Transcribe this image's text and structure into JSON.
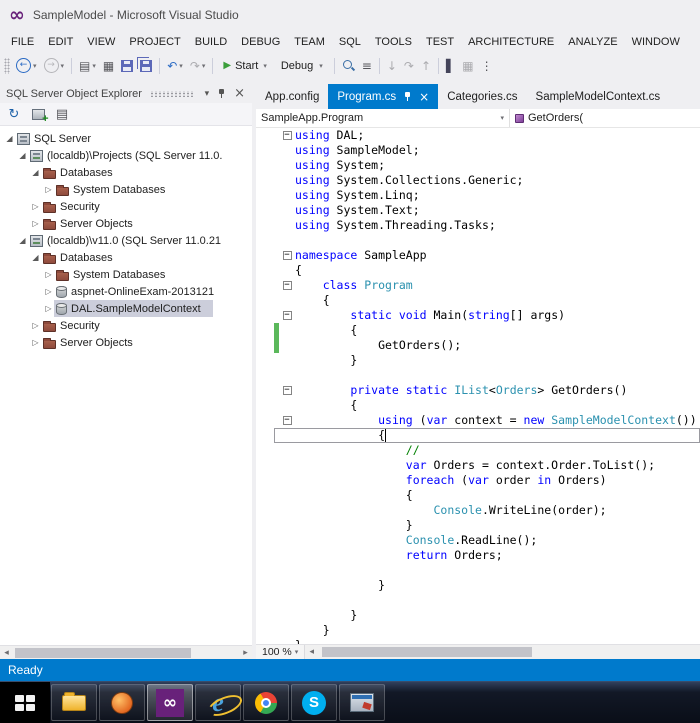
{
  "titlebar": {
    "title": "SampleModel - Microsoft Visual Studio"
  },
  "menu": {
    "items": [
      "FILE",
      "EDIT",
      "VIEW",
      "PROJECT",
      "BUILD",
      "DEBUG",
      "TEAM",
      "SQL",
      "TOOLS",
      "TEST",
      "ARCHITECTURE",
      "ANALYZE",
      "WINDOW"
    ]
  },
  "toolbar": {
    "start_label": "Start",
    "configuration": "Debug",
    "buttons": [
      {
        "type": "icon",
        "name": "navigate-backward",
        "glyph": "←",
        "cls": "circ blue",
        "dd": true
      },
      {
        "type": "icon",
        "name": "navigate-forward",
        "glyph": "→",
        "cls": "circ disabled",
        "dd": true
      },
      {
        "type": "sep"
      },
      {
        "type": "icon",
        "name": "new-project",
        "glyph": "▤",
        "cls": "ink",
        "dd": true
      },
      {
        "type": "icon",
        "name": "add-item",
        "glyph": "▦",
        "cls": "ink"
      },
      {
        "type": "icon",
        "name": "save",
        "cls": "floppy"
      },
      {
        "type": "icon",
        "name": "save-all",
        "cls": "floppy double"
      },
      {
        "type": "sep"
      },
      {
        "type": "icon",
        "name": "undo",
        "glyph": "↶",
        "cls": "blue",
        "dd": true
      },
      {
        "type": "icon",
        "name": "redo",
        "glyph": "↷",
        "cls": "disabled",
        "dd": true
      },
      {
        "type": "sep"
      },
      {
        "type": "start"
      },
      {
        "type": "combo",
        "name": "solution-configurations"
      },
      {
        "type": "sep"
      },
      {
        "type": "icon",
        "name": "find-in-files",
        "cls": "magnifier"
      },
      {
        "type": "icon",
        "name": "solution-platforms",
        "glyph": "≡",
        "cls": "ink"
      },
      {
        "type": "sep"
      },
      {
        "type": "icon",
        "name": "step-into",
        "glyph": "↓",
        "cls": "disabled"
      },
      {
        "type": "icon",
        "name": "step-over",
        "glyph": "↷",
        "cls": "disabled"
      },
      {
        "type": "icon",
        "name": "step-out",
        "glyph": "↑",
        "cls": "disabled"
      },
      {
        "type": "sep"
      },
      {
        "type": "icon",
        "name": "breakpoints",
        "glyph": "▌",
        "cls": "dark"
      },
      {
        "type": "icon",
        "name": "output-window",
        "glyph": "▦",
        "cls": "disabled"
      },
      {
        "type": "icon",
        "name": "toolbar-overflow",
        "glyph": "⋮",
        "cls": "ink"
      }
    ]
  },
  "explorer": {
    "title": "SQL Server Object Explorer",
    "toolbar_icons": [
      {
        "name": "refresh",
        "glyph": "↻",
        "cls": "xblue"
      },
      {
        "name": "add-sql-server",
        "kind": "addsrv"
      },
      {
        "name": "group-by",
        "glyph": "▤",
        "cls": "xink"
      }
    ],
    "tree": [
      {
        "depth": 0,
        "state": "expanded",
        "icon": "server",
        "label": "SQL Server"
      },
      {
        "depth": 1,
        "state": "expanded",
        "icon": "instance",
        "label": "(localdb)\\Projects (SQL Server 11.0."
      },
      {
        "depth": 2,
        "state": "expanded",
        "icon": "folder",
        "label": "Databases"
      },
      {
        "depth": 3,
        "state": "collapsed",
        "icon": "folder",
        "label": "System Databases"
      },
      {
        "depth": 2,
        "state": "collapsed",
        "icon": "folder",
        "label": "Security"
      },
      {
        "depth": 2,
        "state": "collapsed",
        "icon": "folder",
        "label": "Server Objects"
      },
      {
        "depth": 1,
        "state": "expanded",
        "icon": "instance",
        "label": "(localdb)\\v11.0 (SQL Server 11.0.21"
      },
      {
        "depth": 2,
        "state": "expanded",
        "icon": "folder",
        "label": "Databases"
      },
      {
        "depth": 3,
        "state": "collapsed",
        "icon": "folder",
        "label": "System Databases"
      },
      {
        "depth": 3,
        "state": "collapsed",
        "icon": "database",
        "label": "aspnet-OnlineExam-2013121"
      },
      {
        "depth": 3,
        "state": "collapsed",
        "icon": "database",
        "label": "DAL.SampleModelContext",
        "selected": true
      },
      {
        "depth": 2,
        "state": "collapsed",
        "icon": "folder",
        "label": "Security"
      },
      {
        "depth": 2,
        "state": "collapsed",
        "icon": "folder",
        "label": "Server Objects"
      }
    ]
  },
  "editor": {
    "tabs": [
      {
        "label": "App.config",
        "active": false
      },
      {
        "label": "Program.cs",
        "active": true
      },
      {
        "label": "Categories.cs",
        "active": false
      },
      {
        "label": "SampleModelContext.cs",
        "active": false
      }
    ],
    "navbar": {
      "scope": "SampleApp.Program",
      "member": "GetOrders("
    },
    "zoom": "100 %",
    "lines": [
      {
        "fold": true,
        "tokens": [
          [
            "k",
            "using"
          ],
          [
            "p",
            " DAL;"
          ]
        ]
      },
      {
        "tokens": [
          [
            "k",
            "using"
          ],
          [
            "p",
            " SampleModel;"
          ]
        ]
      },
      {
        "tokens": [
          [
            "k",
            "using"
          ],
          [
            "p",
            " System;"
          ]
        ]
      },
      {
        "tokens": [
          [
            "k",
            "using"
          ],
          [
            "p",
            " System.Collections.Generic;"
          ]
        ]
      },
      {
        "tokens": [
          [
            "k",
            "using"
          ],
          [
            "p",
            " System.Linq;"
          ]
        ]
      },
      {
        "tokens": [
          [
            "k",
            "using"
          ],
          [
            "p",
            " System.Text;"
          ]
        ]
      },
      {
        "tokens": [
          [
            "k",
            "using"
          ],
          [
            "p",
            " System.Threading.Tasks;"
          ]
        ]
      },
      {
        "tokens": []
      },
      {
        "fold": true,
        "tokens": [
          [
            "k",
            "namespace"
          ],
          [
            "p",
            " SampleApp"
          ]
        ]
      },
      {
        "tokens": [
          [
            "p",
            "{"
          ]
        ]
      },
      {
        "fold": true,
        "tokens": [
          [
            "p",
            "    "
          ],
          [
            "k",
            "class"
          ],
          [
            "p",
            " "
          ],
          [
            "t",
            "Program"
          ]
        ]
      },
      {
        "tokens": [
          [
            "p",
            "    {"
          ]
        ]
      },
      {
        "fold": true,
        "tokens": [
          [
            "p",
            "        "
          ],
          [
            "k",
            "static"
          ],
          [
            "p",
            " "
          ],
          [
            "k",
            "void"
          ],
          [
            "p",
            " Main("
          ],
          [
            "k",
            "string"
          ],
          [
            "p",
            "[] args)"
          ]
        ]
      },
      {
        "change": true,
        "tokens": [
          [
            "p",
            "        {"
          ]
        ]
      },
      {
        "change": true,
        "tokens": [
          [
            "p",
            "            GetOrders();"
          ]
        ]
      },
      {
        "tokens": [
          [
            "p",
            "        }"
          ]
        ]
      },
      {
        "tokens": []
      },
      {
        "fold": true,
        "tokens": [
          [
            "p",
            "        "
          ],
          [
            "k",
            "private"
          ],
          [
            "p",
            " "
          ],
          [
            "k",
            "static"
          ],
          [
            "p",
            " "
          ],
          [
            "t",
            "IList"
          ],
          [
            "p",
            "<"
          ],
          [
            "t",
            "Orders"
          ],
          [
            "p",
            "> GetOrders()"
          ]
        ]
      },
      {
        "tokens": [
          [
            "p",
            "        {"
          ]
        ]
      },
      {
        "fold": true,
        "tokens": [
          [
            "p",
            "            "
          ],
          [
            "k",
            "using"
          ],
          [
            "p",
            " ("
          ],
          [
            "k",
            "var"
          ],
          [
            "p",
            " context = "
          ],
          [
            "k",
            "new"
          ],
          [
            "p",
            " "
          ],
          [
            "t",
            "SampleModelContext"
          ],
          [
            "p",
            "())"
          ]
        ]
      },
      {
        "current": true,
        "caret": true,
        "tokens": [
          [
            "p",
            "            {"
          ]
        ]
      },
      {
        "tokens": [
          [
            "p",
            "                "
          ],
          [
            "c",
            "//"
          ]
        ]
      },
      {
        "tokens": [
          [
            "p",
            "                "
          ],
          [
            "k",
            "var"
          ],
          [
            "p",
            " Orders = context.Order.ToList();"
          ]
        ]
      },
      {
        "tokens": [
          [
            "p",
            "                "
          ],
          [
            "k",
            "foreach"
          ],
          [
            "p",
            " ("
          ],
          [
            "k",
            "var"
          ],
          [
            "p",
            " order "
          ],
          [
            "k",
            "in"
          ],
          [
            "p",
            " Orders)"
          ]
        ]
      },
      {
        "tokens": [
          [
            "p",
            "                {"
          ]
        ]
      },
      {
        "tokens": [
          [
            "p",
            "                    "
          ],
          [
            "t",
            "Console"
          ],
          [
            "p",
            ".WriteLine(order);"
          ]
        ]
      },
      {
        "tokens": [
          [
            "p",
            "                }"
          ]
        ]
      },
      {
        "tokens": [
          [
            "p",
            "                "
          ],
          [
            "t",
            "Console"
          ],
          [
            "p",
            ".ReadLine();"
          ]
        ]
      },
      {
        "tokens": [
          [
            "p",
            "                "
          ],
          [
            "k",
            "return"
          ],
          [
            "p",
            " Orders;"
          ]
        ]
      },
      {
        "tokens": []
      },
      {
        "tokens": [
          [
            "p",
            "            }"
          ]
        ]
      },
      {
        "tokens": []
      },
      {
        "tokens": [
          [
            "p",
            "        }"
          ]
        ]
      },
      {
        "tokens": [
          [
            "p",
            "    }"
          ]
        ]
      },
      {
        "tokens": [
          [
            "p",
            "}"
          ]
        ]
      }
    ]
  },
  "statusbar": {
    "text": "Ready"
  },
  "taskbar": {
    "items": [
      {
        "name": "start-button"
      },
      {
        "name": "file-explorer"
      },
      {
        "name": "media-player"
      },
      {
        "name": "visual-studio",
        "active": true
      },
      {
        "name": "internet-explorer"
      },
      {
        "name": "google-chrome"
      },
      {
        "name": "skype"
      },
      {
        "name": "system-utility"
      }
    ]
  }
}
